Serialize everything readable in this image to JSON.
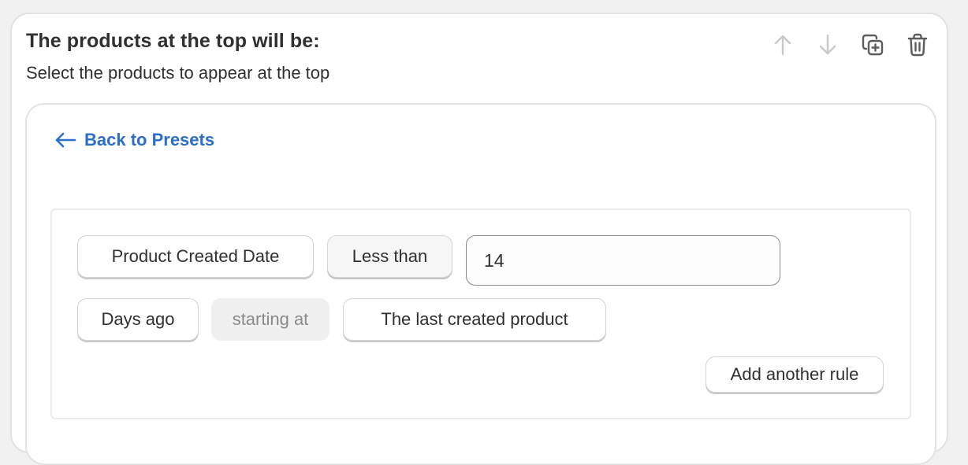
{
  "card": {
    "title": "The products at the top will be:",
    "subtitle": "Select the products to appear at the top"
  },
  "actions": {
    "icons": [
      "arrow-up-icon",
      "arrow-down-icon",
      "duplicate-icon",
      "trash-icon"
    ]
  },
  "back_link": {
    "label": "Back to Presets",
    "color": "#2c6ecb"
  },
  "rule": {
    "field_label": "Product Created Date",
    "operator_label": "Less than",
    "value": "14",
    "unit_label": "Days ago",
    "connector_text": "starting at",
    "reference_label": "The last created product"
  },
  "add_rule_label": "Add another rule"
}
